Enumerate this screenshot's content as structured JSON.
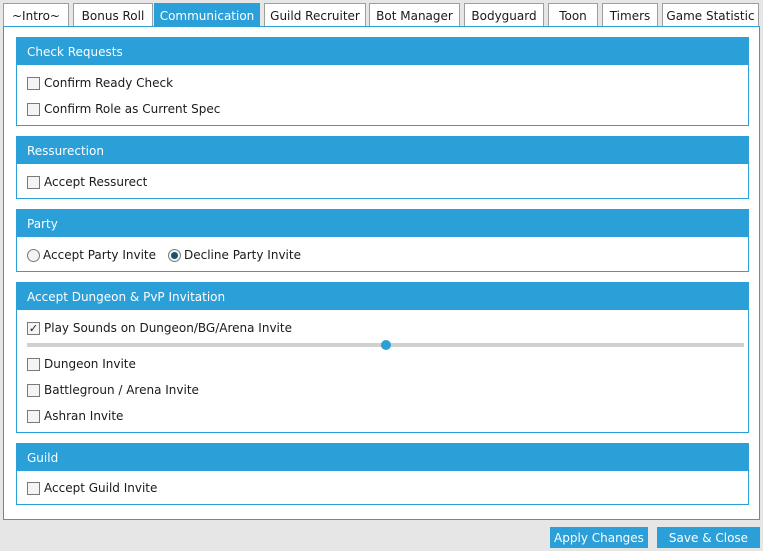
{
  "tabs": [
    {
      "label": "~Intro~"
    },
    {
      "label": "Bonus Roll"
    },
    {
      "label": "Communication",
      "active": true
    },
    {
      "label": "Guild Recruiter"
    },
    {
      "label": "Bot Manager"
    },
    {
      "label": "Bodyguard"
    },
    {
      "label": "Toon"
    },
    {
      "label": "Timers"
    },
    {
      "label": "Game Statistic"
    }
  ],
  "groups": {
    "check_requests": {
      "title": "Check Requests",
      "confirm_ready_check": {
        "label": "Confirm Ready Check",
        "checked": false
      },
      "confirm_role": {
        "label": "Confirm Role as Current Spec",
        "checked": false
      }
    },
    "resurrection": {
      "title": "Ressurection",
      "accept_resurrect": {
        "label": "Accept Ressurect",
        "checked": false
      }
    },
    "party": {
      "title": "Party",
      "accept_invite": {
        "label": "Accept Party Invite",
        "selected": false
      },
      "decline_invite": {
        "label": "Decline Party Invite",
        "selected": true
      }
    },
    "dungeon_pvp": {
      "title": "Accept Dungeon & PvP Invitation",
      "play_sounds": {
        "label": "Play Sounds on Dungeon/BG/Arena Invite",
        "checked": true
      },
      "volume_fraction": 0.5,
      "dungeon_invite": {
        "label": "Dungeon Invite",
        "checked": false
      },
      "battleground_invite": {
        "label": "Battlegroun / Arena Invite",
        "checked": false
      },
      "ashran_invite": {
        "label": "Ashran Invite",
        "checked": false
      }
    },
    "guild": {
      "title": "Guild",
      "accept_guild_invite": {
        "label": "Accept Guild Invite",
        "checked": false
      }
    }
  },
  "footer": {
    "apply_label": "Apply Changes",
    "save_close_label": "Save & Close"
  },
  "glyphs": {
    "checkmark": "✓"
  },
  "colors": {
    "accent": "#2a9fd8"
  }
}
